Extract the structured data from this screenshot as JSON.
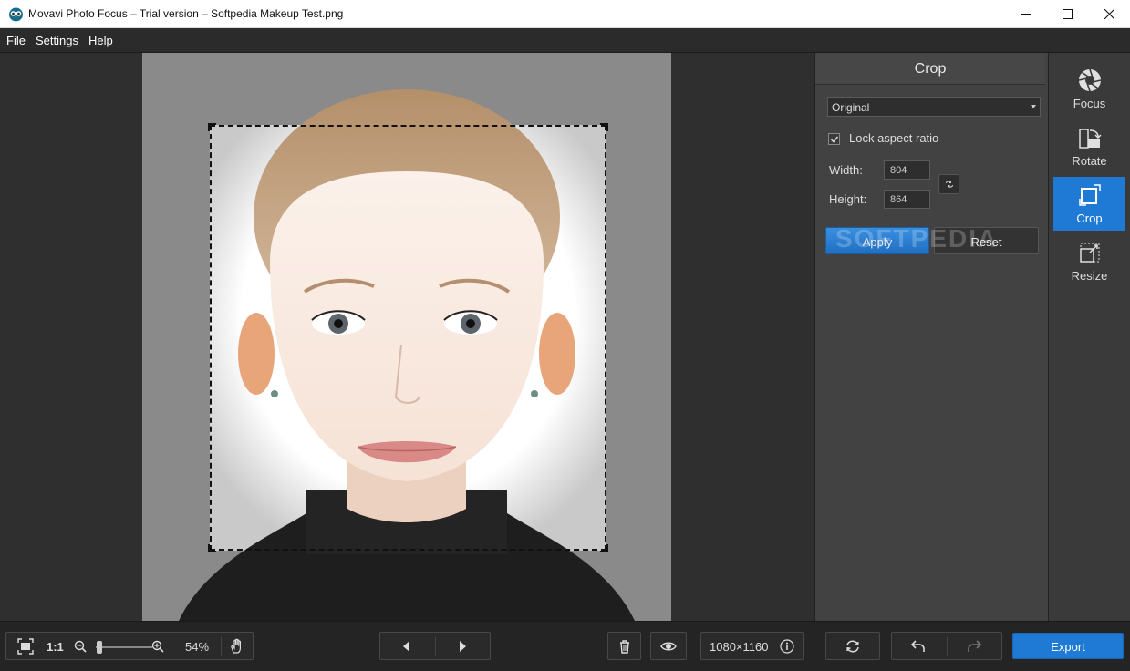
{
  "window": {
    "title": "Movavi Photo Focus – Trial version – Softpedia Makeup Test.png"
  },
  "menu": {
    "file": "File",
    "settings": "Settings",
    "help": "Help"
  },
  "crop_panel": {
    "title": "Crop",
    "aspect_select": "Original",
    "lock_label": "Lock aspect ratio",
    "lock_checked": true,
    "width_label": "Width:",
    "width_value": "804",
    "height_label": "Height:",
    "height_value": "864",
    "apply_label": "Apply",
    "reset_label": "Reset",
    "watermark": "SOFTPEDIA"
  },
  "tools": {
    "focus": "Focus",
    "rotate": "Rotate",
    "crop": "Crop",
    "resize": "Resize",
    "active": "crop"
  },
  "bottom": {
    "one_to_one": "1:1",
    "zoom": "54%",
    "dimensions": "1080×1160",
    "export_label": "Export"
  },
  "colors": {
    "accent": "#1f7ad6",
    "panel": "#424242",
    "canvas": "#2f2f2f"
  }
}
